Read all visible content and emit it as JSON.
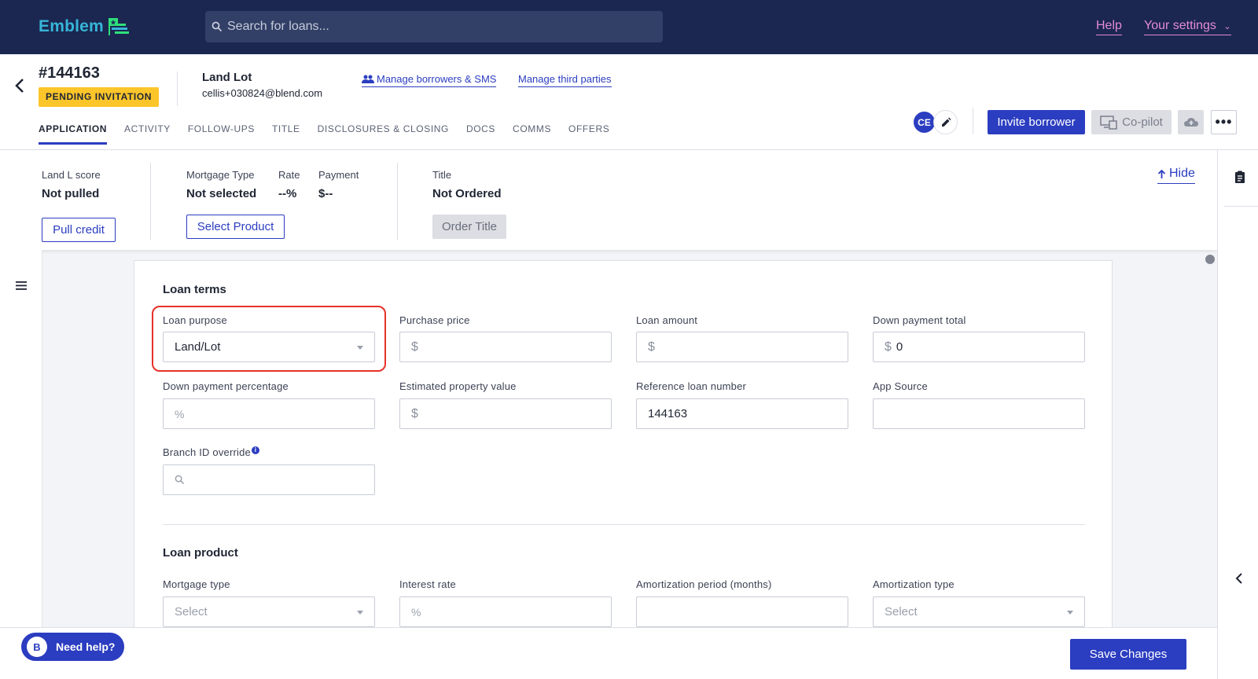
{
  "app": {
    "logo_text": "Emblem"
  },
  "topbar": {
    "search_placeholder": "Search for loans...",
    "help": "Help",
    "settings": "Your settings"
  },
  "loan": {
    "number": "#144163",
    "status": "PENDING INVITATION",
    "borrower_name": "Land Lot",
    "borrower_email": "cellis+030824@blend.com",
    "manage_borrowers": "Manage borrowers & SMS",
    "manage_third_parties": "Manage third parties",
    "avatar_initials": "CE",
    "invite_button": "Invite borrower",
    "copilot_button": "Co-pilot"
  },
  "tabs": [
    {
      "label": "APPLICATION",
      "active": true
    },
    {
      "label": "ACTIVITY"
    },
    {
      "label": "FOLLOW-UPS"
    },
    {
      "label": "TITLE"
    },
    {
      "label": "DISCLOSURES & CLOSING"
    },
    {
      "label": "DOCS"
    },
    {
      "label": "COMMS"
    },
    {
      "label": "OFFERS"
    }
  ],
  "summary": {
    "score_label": "Land L score",
    "score_value": "Not pulled",
    "pull_credit": "Pull credit",
    "mortgage_type_label": "Mortgage Type",
    "mortgage_type_value": "Not selected",
    "rate_label": "Rate",
    "rate_value": "--%",
    "payment_label": "Payment",
    "payment_value": "$--",
    "select_product": "Select Product",
    "title_label": "Title",
    "title_value": "Not Ordered",
    "order_title": "Order Title",
    "hide": "Hide"
  },
  "loan_terms": {
    "title": "Loan terms",
    "loan_purpose_label": "Loan purpose",
    "loan_purpose_value": "Land/Lot",
    "purchase_price_label": "Purchase price",
    "loan_amount_label": "Loan amount",
    "down_payment_total_label": "Down payment total",
    "down_payment_total_value": "0",
    "down_payment_pct_label": "Down payment percentage",
    "est_property_value_label": "Estimated property value",
    "ref_loan_number_label": "Reference loan number",
    "ref_loan_number_value": "144163",
    "app_source_label": "App Source",
    "branch_id_label": "Branch ID override",
    "currency_prefix": "$",
    "percent_prefix": "%"
  },
  "loan_product": {
    "title": "Loan product",
    "mortgage_type_label": "Mortgage type",
    "mortgage_type_placeholder": "Select",
    "interest_rate_label": "Interest rate",
    "amortization_period_label": "Amortization period (months)",
    "amortization_type_label": "Amortization type",
    "amortization_type_placeholder": "Select"
  },
  "footer": {
    "need_help": "Need help?",
    "save_changes": "Save Changes"
  },
  "colors": {
    "navy": "#1b2751",
    "primary": "#2b3dc0",
    "accent_pink": "#e48ad7",
    "badge_yellow": "#fcc52a",
    "highlight_red": "#e63128"
  }
}
